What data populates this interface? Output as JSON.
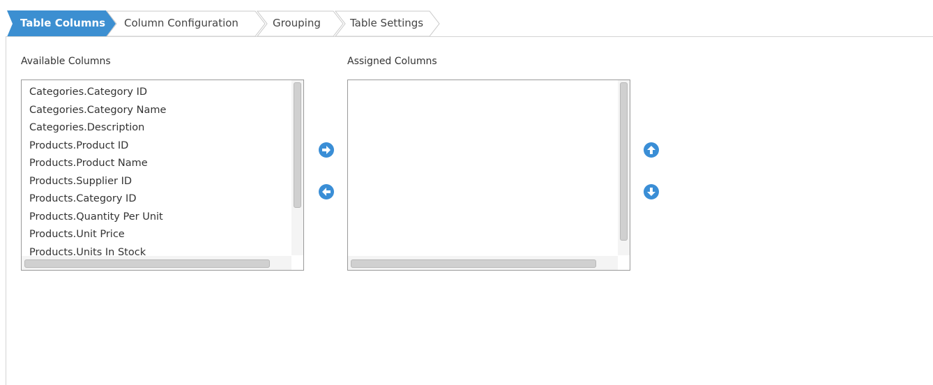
{
  "tabs": [
    {
      "label": "Table Columns",
      "active": true
    },
    {
      "label": "Column Configuration",
      "active": false
    },
    {
      "label": "Grouping",
      "active": false
    },
    {
      "label": "Table Settings",
      "active": false
    }
  ],
  "available": {
    "label": "Available Columns",
    "items": [
      "Categories.Category ID",
      "Categories.Category Name",
      "Categories.Description",
      "Products.Product ID",
      "Products.Product Name",
      "Products.Supplier ID",
      "Products.Category ID",
      "Products.Quantity Per Unit",
      "Products.Unit Price",
      "Products.Units In Stock"
    ]
  },
  "assigned": {
    "label": "Assigned Columns",
    "items": []
  },
  "buttons": {
    "add": "arrow-right-circle-icon",
    "remove": "arrow-left-circle-icon",
    "move_up": "arrow-up-circle-icon",
    "move_down": "arrow-down-circle-icon"
  },
  "colors": {
    "accent": "#3c8fd1",
    "button": "#3a8ed6",
    "tab_border": "#c8c8c8"
  }
}
